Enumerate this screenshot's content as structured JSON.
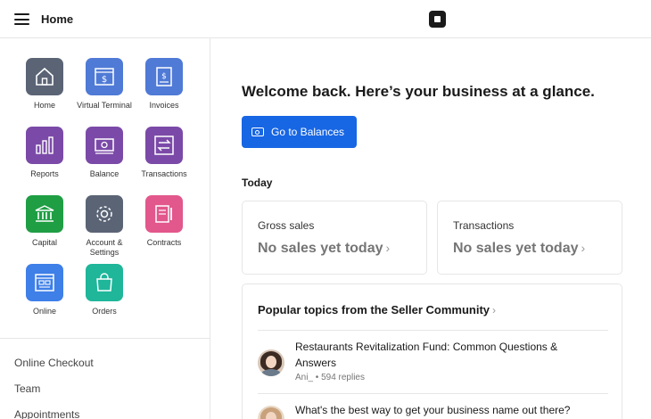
{
  "header": {
    "title": "Home",
    "menu_icon": "hamburger-icon",
    "logo_icon": "square-logo-icon"
  },
  "sidebar": {
    "apps": [
      {
        "label": "Home",
        "icon": "home-icon",
        "color": "#5a6475"
      },
      {
        "label": "Virtual Terminal",
        "icon": "terminal-icon",
        "color": "#4f7ad6"
      },
      {
        "label": "Invoices",
        "icon": "invoice-icon",
        "color": "#4f7ad6"
      },
      {
        "label": "Reports",
        "icon": "reports-icon",
        "color": "#7b4aa8"
      },
      {
        "label": "Balance",
        "icon": "balance-icon",
        "color": "#7b4aa8"
      },
      {
        "label": "Transactions",
        "icon": "transactions-icon",
        "color": "#7b4aa8"
      },
      {
        "label": "Capital",
        "icon": "bank-icon",
        "color": "#1f9e44"
      },
      {
        "label": "Account & Settings",
        "icon": "gear-icon",
        "color": "#5a6475"
      },
      {
        "label": "Contracts",
        "icon": "contract-icon",
        "color": "#e2578c"
      },
      {
        "label": "Online",
        "icon": "online-icon",
        "color": "#3e7fe8"
      },
      {
        "label": "Orders",
        "icon": "orders-icon",
        "color": "#1fb69a"
      }
    ],
    "links": [
      "Online Checkout",
      "Team",
      "Appointments"
    ]
  },
  "main": {
    "welcome": "Welcome back. Here’s your business at a glance.",
    "balances_button": "Go to Balances",
    "today_heading": "Today",
    "cards": [
      {
        "title": "Gross sales",
        "value": "No sales yet today",
        "chevron": "›"
      },
      {
        "title": "Transactions",
        "value": "No sales yet today",
        "chevron": "›"
      }
    ],
    "community": {
      "title": "Popular topics from the Seller Community",
      "chevron": "›",
      "topics": [
        {
          "text": "Restaurants Revitalization Fund: Common Questions & Answers",
          "meta": "Ani_ • 594 replies"
        },
        {
          "text": "What's the best way to get your business name out there?",
          "meta": ""
        }
      ]
    }
  },
  "colors": {
    "primary_button": "#1766e4"
  }
}
